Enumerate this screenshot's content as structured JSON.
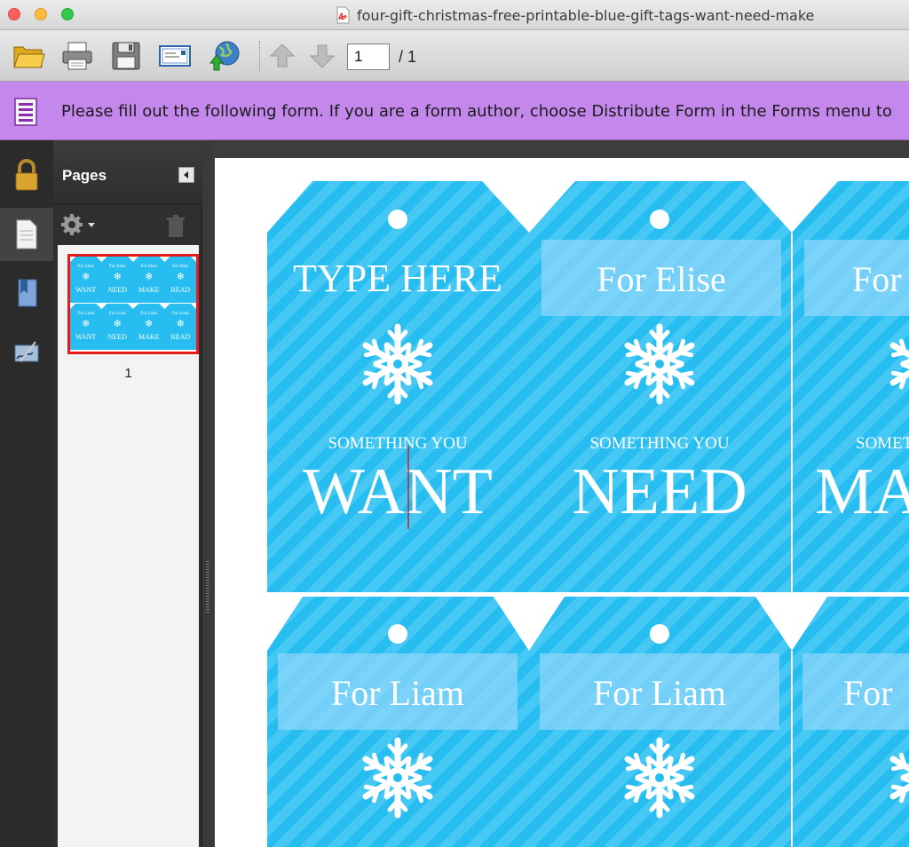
{
  "window": {
    "title": "four-gift-christmas-free-printable-blue-gift-tags-want-need-make"
  },
  "toolbar": {
    "page_current": "1",
    "page_of": "/  1",
    "buttons": [
      "open-folder-icon",
      "print-icon",
      "save-icon",
      "email-icon",
      "web-upload-icon",
      "page-up-icon",
      "page-down-icon"
    ]
  },
  "form_bar": {
    "message": "Please fill out the following form. If you are a form author, choose Distribute Form in the Forms menu to"
  },
  "pages_panel": {
    "title": "Pages",
    "page_number": "1",
    "thumbnail": {
      "top_row": [
        "For Elise",
        "For Elise",
        "For Elise",
        "For Elise"
      ],
      "top_words": [
        "WANT",
        "NEED",
        "MAKE",
        "READ"
      ],
      "bottom_row": [
        "For Liam",
        "For Liam",
        "For Liam",
        "For Liam"
      ],
      "bottom_words": [
        "WANT",
        "NEED",
        "MAKE",
        "READ"
      ]
    }
  },
  "document": {
    "row1": [
      {
        "name_field": "TYPE HERE",
        "subtitle": "SOMETHING YOU",
        "word": "WANT"
      },
      {
        "name_field": "For Elise",
        "subtitle": "SOMETHING YOU",
        "word": "NEED"
      },
      {
        "name_field": "For",
        "subtitle": "SOMETH",
        "word": "MA"
      }
    ],
    "row2": [
      {
        "name_field": "For Liam"
      },
      {
        "name_field": "For Liam"
      },
      {
        "name_field": "For"
      }
    ]
  },
  "colors": {
    "tag_blue": "#27bdf0",
    "stripe_blue": "#45c9f4",
    "field_fill": "#8ed6fb",
    "form_bar": "#c488ec",
    "thumb_highlight": "#e81b1b"
  }
}
